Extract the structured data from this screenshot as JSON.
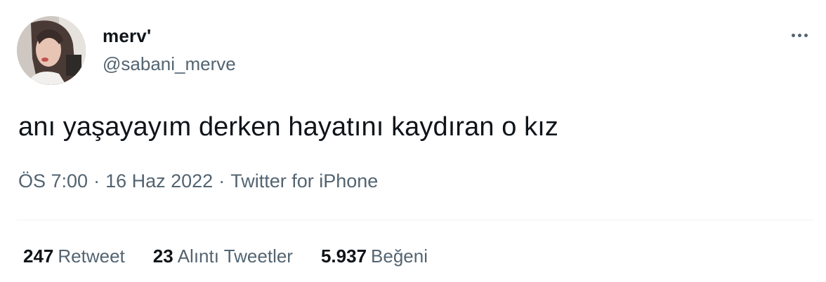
{
  "user": {
    "display_name": "merv'",
    "handle": "@sabani_merve"
  },
  "tweet": {
    "text": "anı yaşayayım derken hayatını kaydıran o kız"
  },
  "meta": {
    "time": "ÖS 7:00",
    "date": "16 Haz 2022",
    "separator": "·",
    "source": "Twitter for iPhone"
  },
  "stats": {
    "retweets": {
      "count": "247",
      "label": "Retweet"
    },
    "quotes": {
      "count": "23",
      "label": "Alıntı Tweetler"
    },
    "likes": {
      "count": "5.937",
      "label": "Beğeni"
    }
  },
  "icons": {
    "more": "more-horizontal-icon"
  },
  "colors": {
    "text_primary": "#0f1419",
    "text_secondary": "#536471",
    "divider": "#eff3f4"
  }
}
